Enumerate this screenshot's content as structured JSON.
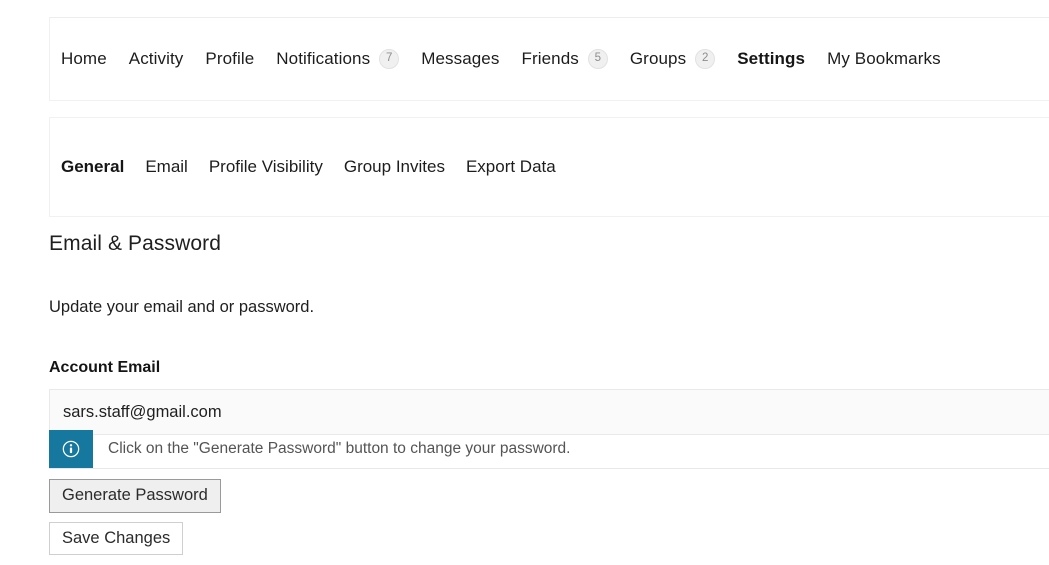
{
  "primary_nav": {
    "items": [
      {
        "label": "Home",
        "badge": null,
        "active": false
      },
      {
        "label": "Activity",
        "badge": null,
        "active": false
      },
      {
        "label": "Profile",
        "badge": null,
        "active": false
      },
      {
        "label": "Notifications",
        "badge": "7",
        "active": false
      },
      {
        "label": "Messages",
        "badge": null,
        "active": false
      },
      {
        "label": "Friends",
        "badge": "5",
        "active": false
      },
      {
        "label": "Groups",
        "badge": "2",
        "active": false
      },
      {
        "label": "Settings",
        "badge": null,
        "active": true
      },
      {
        "label": "My Bookmarks",
        "badge": null,
        "active": false
      }
    ]
  },
  "secondary_nav": {
    "items": [
      {
        "label": "General",
        "active": true
      },
      {
        "label": "Email",
        "active": false
      },
      {
        "label": "Profile Visibility",
        "active": false
      },
      {
        "label": "Group Invites",
        "active": false
      },
      {
        "label": "Export Data",
        "active": false
      }
    ]
  },
  "content": {
    "title": "Email & Password",
    "description": "Update your email and or password.",
    "field_label": "Account Email",
    "email_value": "sars.staff@gmail.com",
    "email_placeholder": "Account Email"
  },
  "notice": {
    "icon": "info-icon",
    "text": "Click on the \"Generate Password\" button to change your password.",
    "accent_color": "#16789e"
  },
  "actions": {
    "generate_password_label": "Generate Password",
    "save_changes_label": "Save Changes"
  }
}
